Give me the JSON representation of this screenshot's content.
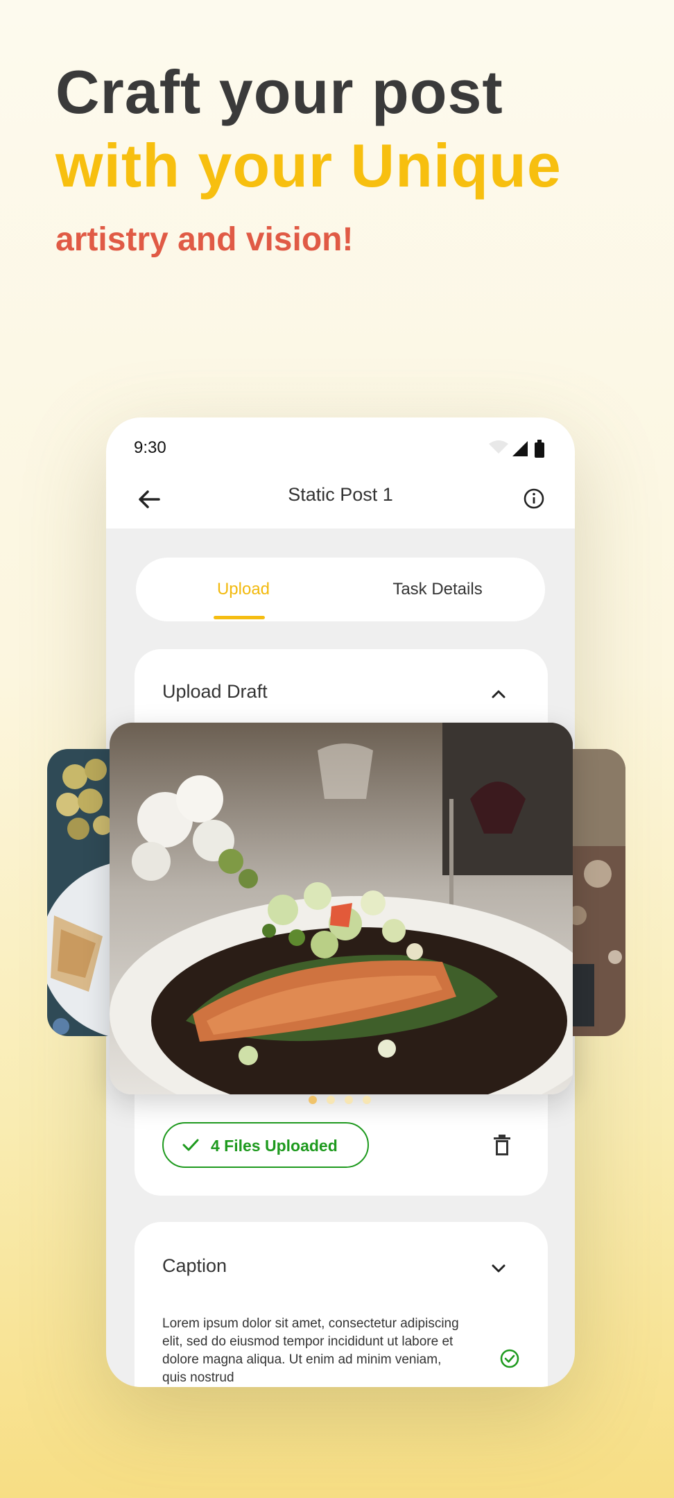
{
  "headline": {
    "line1": "Craft your post",
    "line2": "with your Unique",
    "line3": "artistry and vision!"
  },
  "status_bar": {
    "time": "9:30",
    "icons": [
      "wifi-icon",
      "signal-icon",
      "battery-icon"
    ]
  },
  "nav": {
    "title": "Static Post 1",
    "back_icon": "arrow-left-icon",
    "info_icon": "info-icon"
  },
  "tabs": [
    {
      "label": "Upload",
      "active": true
    },
    {
      "label": "Task Details",
      "active": false
    }
  ],
  "upload_card": {
    "title": "Upload Draft",
    "chevron": "chevron-up-icon",
    "files_label": "4 Files Uploaded",
    "delete_icon": "trash-icon"
  },
  "carousel": {
    "count": 4,
    "active_index": 0,
    "images": [
      "salmon-dish-photo",
      "grapes-and-bread-photo",
      "outdoor-photo"
    ]
  },
  "caption_card": {
    "title": "Caption",
    "chevron": "chevron-down-icon",
    "text": "Lorem ipsum dolor sit amet, consectetur adipiscing elit, sed do eiusmod tempor incididunt ut labore et dolore magna aliqua. Ut enim ad minim veniam, quis nostrud",
    "status_icon": "check-circle-icon"
  },
  "colors": {
    "accent_yellow": "#f7bf0f",
    "accent_red": "#e05a45",
    "success_green": "#1e9a1e",
    "text_dark": "#3a3a3a"
  }
}
